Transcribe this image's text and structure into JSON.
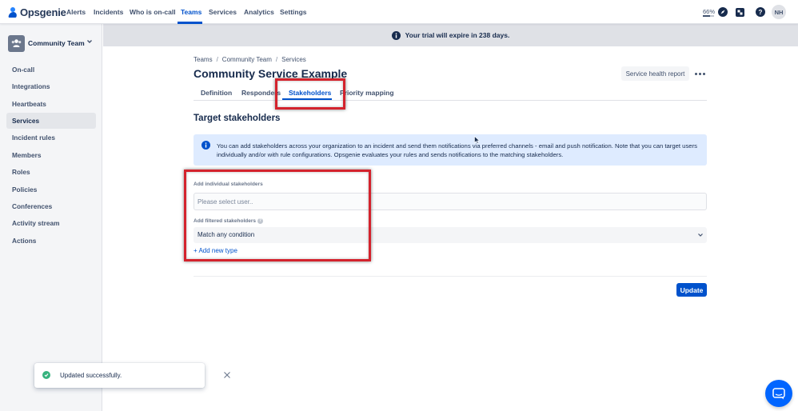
{
  "app": {
    "logo_text": "Opsgenie",
    "nav": [
      "Alerts",
      "Incidents",
      "Who is on-call",
      "Teams",
      "Services",
      "Analytics",
      "Settings"
    ],
    "active_nav": "Teams",
    "zoom_label": "66%",
    "zoom_level": 0.66,
    "user_initials": "NH",
    "icons": [
      "compass-icon",
      "app-switcher-icon",
      "help-icon"
    ]
  },
  "sidebar": {
    "team_name": "Community Team",
    "items": [
      {
        "label": "On-call"
      },
      {
        "label": "Integrations"
      },
      {
        "label": "Heartbeats"
      },
      {
        "label": "Services",
        "active": true
      },
      {
        "label": "Incident rules"
      },
      {
        "label": "Members"
      },
      {
        "label": "Roles"
      },
      {
        "label": "Policies"
      },
      {
        "label": "Conferences"
      },
      {
        "label": "Activity stream"
      },
      {
        "label": "Actions"
      }
    ]
  },
  "banner": {
    "text": "Your trial will expire in 238 days."
  },
  "page": {
    "breadcrumb": [
      "Teams",
      "Community Team",
      "Services"
    ],
    "title": "Community Service Example",
    "service_health_label": "Service health report",
    "tabs": [
      "Definition",
      "Responders",
      "Stakeholders",
      "Priority mapping"
    ],
    "active_tab": "Stakeholders",
    "section_title": "Target stakeholders",
    "info_text": "You can add stakeholders across your organization to an incident and send them notifications via preferred channels - email and push notification. Note that you can target users individually and/or with rule configurations. Opsgenie evaluates your rules and sends notifications to the matching stakeholders.",
    "individual_label": "Add individual stakeholders",
    "user_placeholder": "Please select user..",
    "filtered_label": "Add filtered stakeholders",
    "filtered_help": "?",
    "condition_value": "Match any condition",
    "add_type_label": "+ Add new type",
    "update_label": "Update"
  },
  "toast": {
    "text": "Updated successfully."
  },
  "colors": {
    "brand": "#0052cc",
    "highlight": "#d4232d",
    "success": "#36b37e",
    "info_bg": "#deebff"
  }
}
